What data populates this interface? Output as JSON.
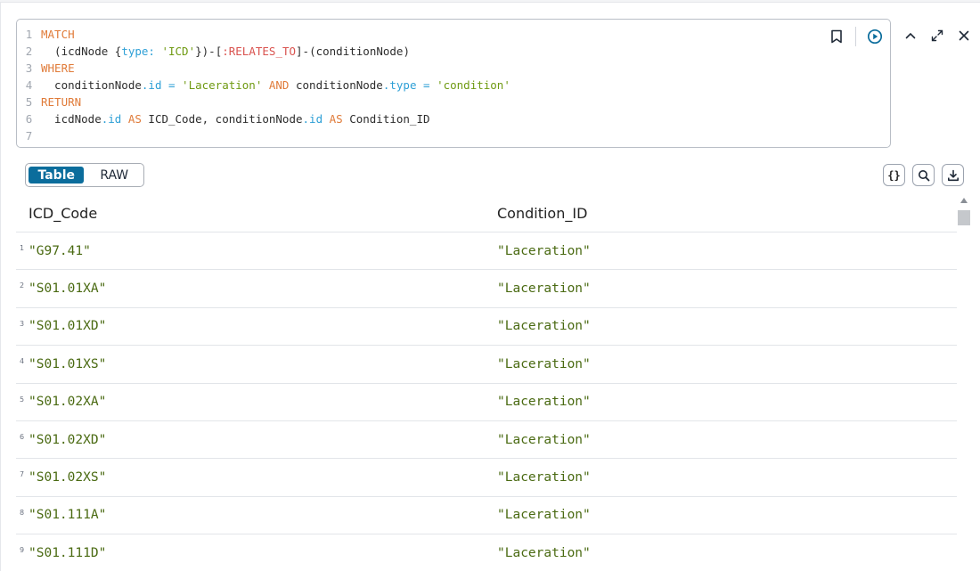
{
  "editor": {
    "lines": [
      {
        "num": "1"
      },
      {
        "num": "2"
      },
      {
        "num": "3"
      },
      {
        "num": "4"
      },
      {
        "num": "5"
      },
      {
        "num": "6"
      },
      {
        "num": "7"
      }
    ],
    "tokens": {
      "l1_kw": "MATCH",
      "l2_a": "  (icdNode {",
      "l2_prop": "type:",
      "l2_sp": " ",
      "l2_str": "'ICD'",
      "l2_b": "})-[",
      "l2_rel": ":RELATES_TO",
      "l2_c": "]-(conditionNode)",
      "l3_kw": "WHERE",
      "l4_a": "  conditionNode",
      "l4_p1": ".id",
      "l4_eq1": " = ",
      "l4_s1": "'Laceration'",
      "l4_and": " AND ",
      "l4_b": "conditionNode",
      "l4_p2": ".type",
      "l4_eq2": " = ",
      "l4_s2": "'condition'",
      "l5_kw": "RETURN",
      "l6_a": "  icdNode",
      "l6_p1": ".id",
      "l6_as1": " AS ",
      "l6_b": "ICD_Code, conditionNode",
      "l6_p2": ".id",
      "l6_as2": " AS ",
      "l6_c": "Condition_ID"
    }
  },
  "view_toggle": {
    "table_label": "Table",
    "raw_label": "RAW",
    "selected": "Table"
  },
  "tools": {
    "json_label": "{}"
  },
  "table": {
    "columns": [
      "ICD_Code",
      "Condition_ID"
    ],
    "rows": [
      {
        "n": "1",
        "icd": "\"G97.41\"",
        "cond": "\"Laceration\""
      },
      {
        "n": "2",
        "icd": "\"S01.01XA\"",
        "cond": "\"Laceration\""
      },
      {
        "n": "3",
        "icd": "\"S01.01XD\"",
        "cond": "\"Laceration\""
      },
      {
        "n": "4",
        "icd": "\"S01.01XS\"",
        "cond": "\"Laceration\""
      },
      {
        "n": "5",
        "icd": "\"S01.02XA\"",
        "cond": "\"Laceration\""
      },
      {
        "n": "6",
        "icd": "\"S01.02XD\"",
        "cond": "\"Laceration\""
      },
      {
        "n": "7",
        "icd": "\"S01.02XS\"",
        "cond": "\"Laceration\""
      },
      {
        "n": "8",
        "icd": "\"S01.111A\"",
        "cond": "\"Laceration\""
      },
      {
        "n": "9",
        "icd": "\"S01.111D\"",
        "cond": "\"Laceration\""
      }
    ]
  },
  "icons": {
    "bookmark": "bookmark-icon",
    "run": "play-circle-icon",
    "collapse": "chevron-up-icon",
    "expand": "expand-icon",
    "close": "close-icon",
    "search": "search-icon",
    "download": "download-icon"
  },
  "colors": {
    "accent": "#0b6d9c",
    "keyword": "#e07b39",
    "string": "#6f9a12",
    "property": "#2d9fd6",
    "relation": "#d9534f"
  }
}
